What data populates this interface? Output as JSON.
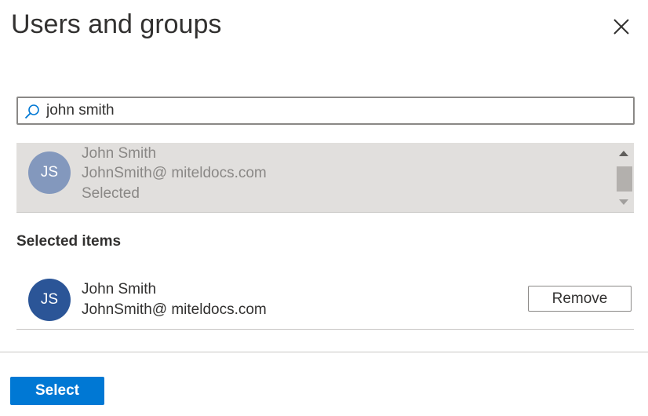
{
  "panel": {
    "title": "Users and groups",
    "close_icon": "close-icon"
  },
  "search": {
    "icon": "search-icon",
    "value": "john smith",
    "accent_color": "#0078d4"
  },
  "results": [
    {
      "initials": "JS",
      "name": "John Smith",
      "email": "JohnSmith@ miteldocs.com",
      "status": "Selected",
      "avatar_color": "#8398bd"
    }
  ],
  "selected_items": {
    "heading": "Selected items",
    "items": [
      {
        "initials": "JS",
        "name": "John Smith",
        "email": "JohnSmith@ miteldocs.com",
        "avatar_color": "#2b5597",
        "remove_label": "Remove"
      }
    ]
  },
  "footer": {
    "select_label": "Select",
    "select_color": "#0078d4"
  }
}
